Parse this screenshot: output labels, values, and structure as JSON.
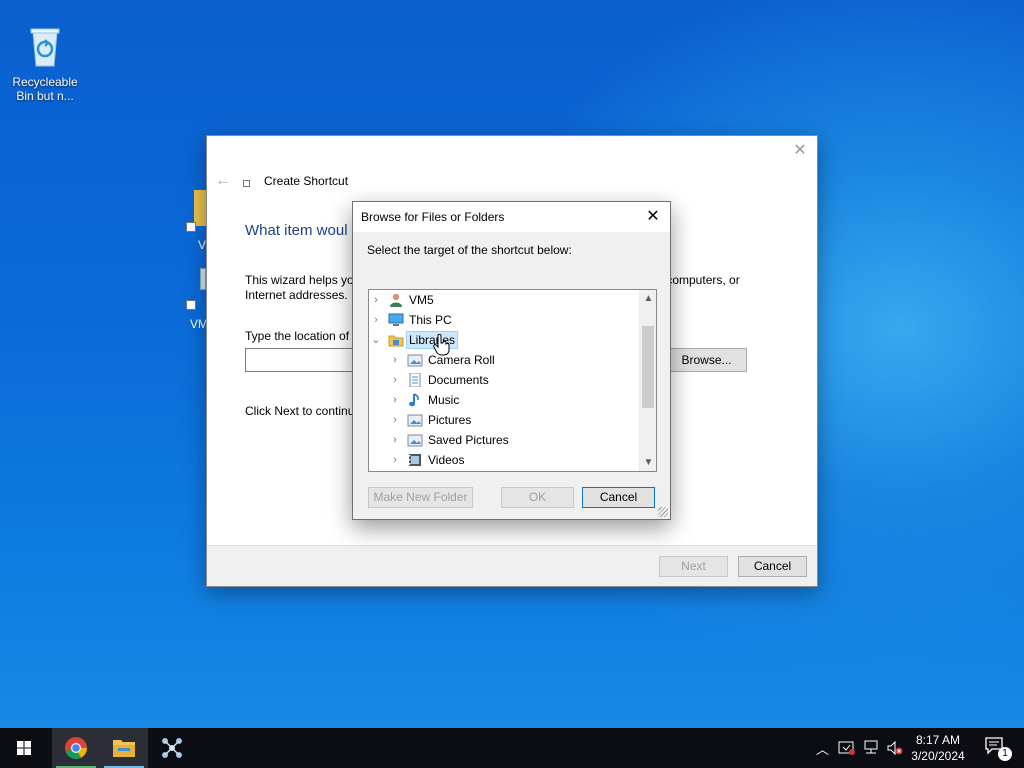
{
  "desktop": {
    "recycle_bin_label": "Recycleable Bin but n...",
    "partial_icon_label_1": "V",
    "partial_icon_label_2": "VM"
  },
  "wizard": {
    "title": "Create Shortcut",
    "heading": "What item woul",
    "description_left": "This wizard helps you",
    "description_right": "ers, computers, or",
    "description_line2": "Internet addresses.",
    "location_label": "Type the location of t",
    "input_value": "",
    "browse_label": "Browse...",
    "next_hint": "Click Next to continu",
    "next_label": "Next",
    "cancel_label": "Cancel"
  },
  "browse_dialog": {
    "title": "Browse for Files or Folders",
    "prompt": "Select the target of the shortcut below:",
    "tree": [
      {
        "label": "VM5",
        "level": 0,
        "expanded": false,
        "icon": "user-icon"
      },
      {
        "label": "This PC",
        "level": 0,
        "expanded": false,
        "icon": "computer-icon"
      },
      {
        "label": "Libraries",
        "level": 0,
        "expanded": true,
        "selected": true,
        "icon": "libraries-icon"
      },
      {
        "label": "Camera Roll",
        "level": 1,
        "expanded": false,
        "icon": "picture-library-icon"
      },
      {
        "label": "Documents",
        "level": 1,
        "expanded": false,
        "icon": "documents-icon"
      },
      {
        "label": "Music",
        "level": 1,
        "expanded": false,
        "icon": "music-icon"
      },
      {
        "label": "Pictures",
        "level": 1,
        "expanded": false,
        "icon": "picture-library-icon"
      },
      {
        "label": "Saved Pictures",
        "level": 1,
        "expanded": false,
        "icon": "picture-library-icon"
      },
      {
        "label": "Videos",
        "level": 1,
        "expanded": false,
        "icon": "videos-icon"
      }
    ],
    "make_new_folder_label": "Make New Folder",
    "ok_label": "OK",
    "cancel_label": "Cancel"
  },
  "taskbar": {
    "apps": [
      "chrome-icon",
      "file-explorer-icon",
      "network-app-icon"
    ],
    "time": "8:17 AM",
    "date": "3/20/2024",
    "notification_count": "1"
  },
  "colors": {
    "accent": "#0078d7",
    "heading_blue": "#1e3f8c",
    "selection": "#cce8ff"
  }
}
